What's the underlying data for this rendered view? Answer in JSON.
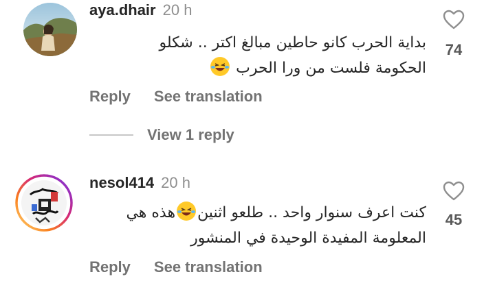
{
  "comments": [
    {
      "username": "aya.dhair",
      "time": "20 h",
      "line1": "بداية الحرب كانو حاطين مبالغ اكتر .. شكلو",
      "line2": "الحكومة فلست من ورا الحرب",
      "likes": "74",
      "reply_label": "Reply",
      "translate_label": "See translation",
      "view_replies_label": "View 1 reply"
    },
    {
      "username": "nesol414",
      "time": "20 h",
      "line1_a": "كنت اعرف سنوار واحد .. طلعو اثنين",
      "line1_b": "هذه هي",
      "line2": "المعلومة المفيدة الوحيدة في المنشور",
      "likes": "45",
      "reply_label": "Reply",
      "translate_label": "See translation"
    }
  ],
  "icons": {
    "heart": "heart-outline-icon",
    "emoji": "laughing-emoji-icon"
  },
  "colors": {
    "text": "#262626",
    "secondary": "#737373",
    "story_ring": [
      "#feda75",
      "#fa7e1e",
      "#d62976",
      "#962fbf",
      "#4f5bd5"
    ]
  }
}
